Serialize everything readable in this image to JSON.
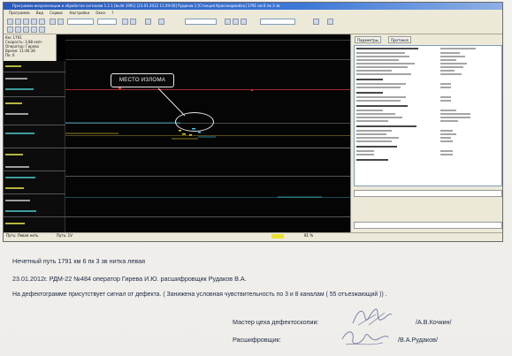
{
  "screenshot": {
    "window_title": "Программа визуализации и обработки сигналов 1.2.1 [build 1991] [23.01.2012 11:29:00] Рудаков 1 [Станция Красноармейск] 1791 км 6 пк 3 зв",
    "menu": [
      "Программа",
      "Вид",
      "Сервис",
      "Настройки",
      "Окно",
      "?"
    ],
    "left_info": [
      "Км: 1791",
      "Скорость: 3.88 км/ч",
      "Оператор: Гирева",
      "Время: 11:46:38",
      "Пк: 6",
      "Зв: 3"
    ],
    "tabs": [
      "Параметры",
      "Протокол"
    ],
    "callout_label": "МЕСТО ИЗЛОМА",
    "status_left": "Путь: Левая нить",
    "status_mid": "Путь: 1V",
    "status_right": "81 %"
  },
  "document": {
    "line1": "Нечетный путь 1791 км 6 пк 3 зв нитка левая",
    "line2": "23.01.2012г. РДМ-22 №484 оператор Гирева И.Ю. расшифровщик Рудаков В.А.",
    "line3": "На дефектограмме присутствует сигнал от дефекта. ( Занижена условная чувствительность по 3 и 8 каналам ( 55 отъезжающий )) .",
    "signers": [
      {
        "role": "Мастер цеха дефектоскопии:",
        "name": "/А.В.Кочкин/"
      },
      {
        "role": "Расшифровщик:",
        "name": "/В.А.Рудаков/"
      }
    ]
  },
  "colors": {
    "ink": "#1c2a44",
    "trace_yellow": "#e8d23a",
    "trace_cyan": "#3ecfe0",
    "trace_red": "#d23a2a",
    "window_blue": "#2a59b9"
  }
}
